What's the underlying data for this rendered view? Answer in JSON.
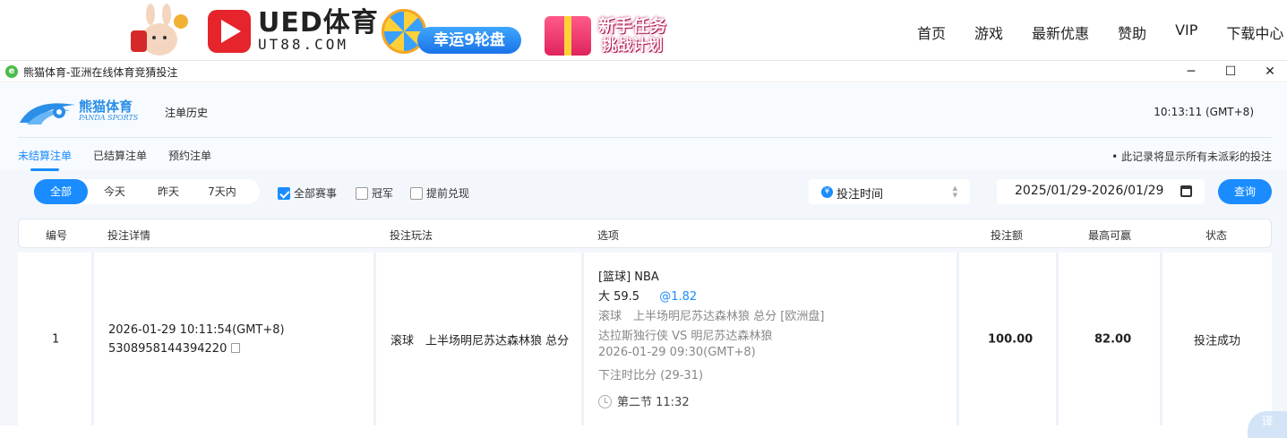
{
  "banner": {
    "brand_title": "UED体育",
    "brand_sub": "UT88.COM",
    "promo_wheel": "幸运9轮盘",
    "promo_task_line1": "新手任务",
    "promo_task_line2": "挑战计划",
    "nav": [
      "首页",
      "游戏",
      "最新优惠",
      "赞助",
      "VIP",
      "下载中心"
    ]
  },
  "window": {
    "title": "熊猫体育-亚洲在线体育竞猜投注",
    "minimize": "─",
    "maximize": "☐",
    "close": "✕"
  },
  "app": {
    "logo_cn": "熊猫体育",
    "logo_en": "PANDA SPORTS",
    "page_title": "注单历史",
    "clock": "10:13:11 (GMT+8)",
    "tabs": [
      {
        "label": "未结算注单",
        "active": true
      },
      {
        "label": "已结算注单",
        "active": false
      },
      {
        "label": "预约注单",
        "active": false
      }
    ],
    "note": "• 此记录将显示所有未派彩的投注"
  },
  "filters": {
    "ranges": [
      {
        "label": "全部",
        "active": true
      },
      {
        "label": "今天",
        "active": false
      },
      {
        "label": "昨天",
        "active": false
      },
      {
        "label": "7天内",
        "active": false
      }
    ],
    "checks": [
      {
        "label": "全部赛事",
        "checked": true
      },
      {
        "label": "冠军",
        "checked": false
      },
      {
        "label": "提前兑现",
        "checked": false
      }
    ],
    "sort_select": "投注时间",
    "currency_icon": "¥",
    "date_range": "2025/01/29-2026/01/29",
    "query_button": "查询"
  },
  "table": {
    "headers": [
      "编号",
      "投注详情",
      "投注玩法",
      "选项",
      "投注额",
      "最高可赢",
      "状态"
    ],
    "rows": [
      {
        "no": "1",
        "bet_time": "2026-01-29 10:11:54(GMT+8)",
        "bet_id": "5308958144394220",
        "play": "滚球　上半场明尼苏达森林狼 总分",
        "option": {
          "league": "[篮球] NBA",
          "pick": "大 59.5",
          "odds": "@1.82",
          "market": "滚球　上半场明尼苏达森林狼 总分 [欧洲盘]",
          "match": "达拉斯独行侠 VS 明尼苏达森林狼",
          "match_time": "2026-01-29 09:30(GMT+8)",
          "score_at_bet": "下注时比分 (29-31)",
          "period": "第二节  11:32"
        },
        "stake": "100.00",
        "max_win": "82.00",
        "status": "投注成功"
      }
    ]
  },
  "colors": {
    "accent": "#1a8cff",
    "brand_red": "#e5252b",
    "background": "#f3f7fc"
  },
  "translate_fab": "译"
}
